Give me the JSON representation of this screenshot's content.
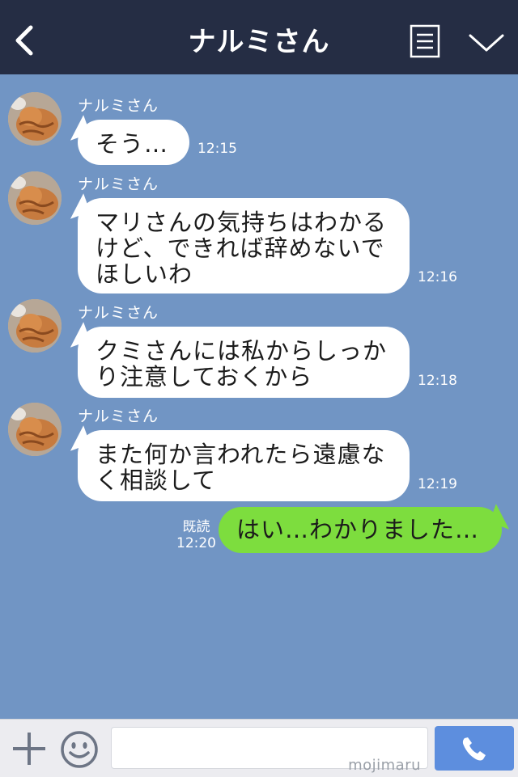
{
  "header": {
    "title": "ナルミさん",
    "back_icon": "chevron-left-icon",
    "menu_icon": "list-icon",
    "expand_icon": "chevron-down-icon"
  },
  "messages": [
    {
      "sender": "ナルミさん",
      "lines": [
        "そう…"
      ],
      "time": "12:15"
    },
    {
      "sender": "ナルミさん",
      "lines": [
        "マリさんの気持ちはわかる",
        "けど、できれば辞めないで",
        "ほしいわ"
      ],
      "time": "12:16"
    },
    {
      "sender": "ナルミさん",
      "lines": [
        "クミさんには私からしっか",
        "り注意しておくから"
      ],
      "time": "12:18"
    },
    {
      "sender": "ナルミさん",
      "lines": [
        "また何か言われたら遠慮な",
        "く相談して"
      ],
      "time": "12:19"
    }
  ],
  "outgoing": {
    "text": "はい…わかりました…",
    "read_label": "既読",
    "time": "12:20"
  },
  "input_bar": {
    "placeholder": "",
    "watermark": "mojimaru",
    "plus_icon": "plus-icon",
    "emoji_icon": "smiley-icon",
    "call_icon": "phone-icon"
  },
  "colors": {
    "header_bg": "#252d44",
    "chat_bg": "#7195c4",
    "incoming_bubble": "#ffffff",
    "outgoing_bubble": "#7ddd3e",
    "call_button": "#5d8ede"
  }
}
